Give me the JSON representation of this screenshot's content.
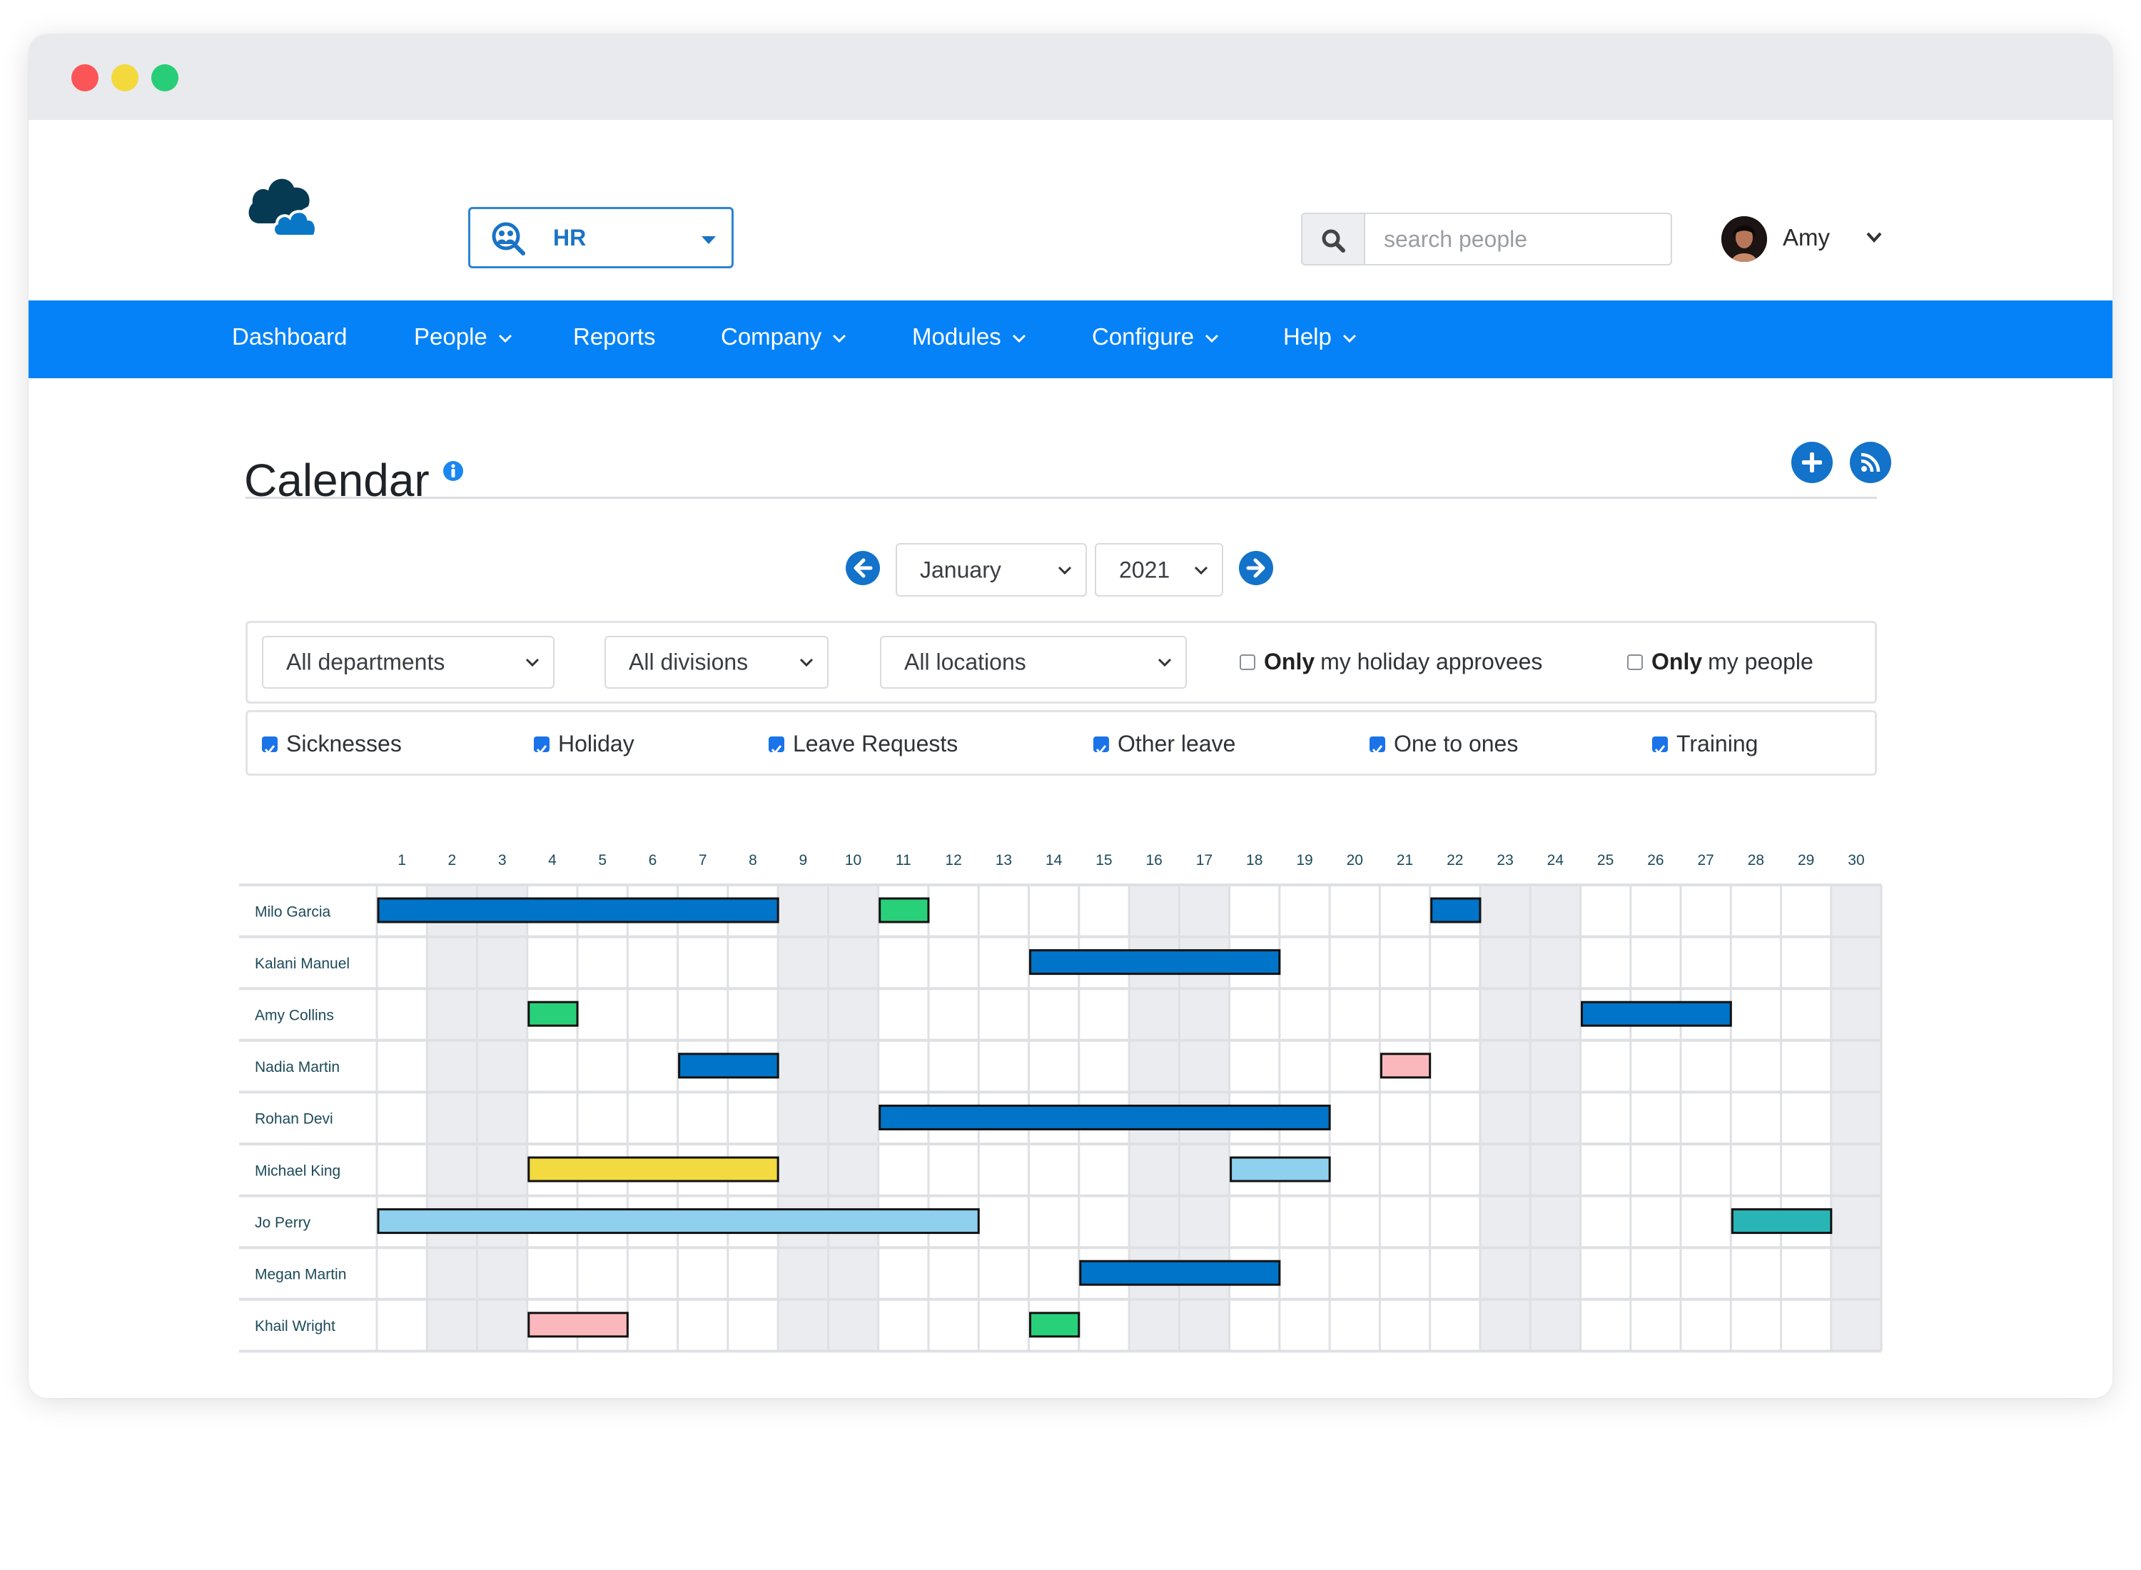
{
  "window": {
    "traffic_lights": [
      "close",
      "minimize",
      "maximize"
    ]
  },
  "header": {
    "module_select": {
      "value": "HR",
      "icon": "people-search-icon"
    },
    "search": {
      "placeholder": "search people",
      "value": "",
      "icon": "search-icon"
    },
    "user": {
      "name": "Amy",
      "avatar": "user-avatar-photo"
    }
  },
  "nav": {
    "items": [
      {
        "label": "Dashboard",
        "dropdown": false
      },
      {
        "label": "People",
        "dropdown": true
      },
      {
        "label": "Reports",
        "dropdown": false
      },
      {
        "label": "Company",
        "dropdown": true
      },
      {
        "label": "Modules",
        "dropdown": true
      },
      {
        "label": "Configure",
        "dropdown": true
      },
      {
        "label": "Help",
        "dropdown": true
      }
    ]
  },
  "page": {
    "title": "Calendar",
    "title_icon": "info-icon",
    "actions": [
      {
        "name": "add-event-button",
        "icon": "plus-icon"
      },
      {
        "name": "rss-feed-button",
        "icon": "rss-icon"
      }
    ]
  },
  "period": {
    "prev_icon": "arrow-left-icon",
    "next_icon": "arrow-right-icon",
    "month": "January",
    "year": "2021"
  },
  "filters": {
    "department": "All departments",
    "division": "All divisions",
    "location": "All locations",
    "holiday_approvees": {
      "bold": "Only",
      "rest": "my holiday approvees",
      "checked": false
    },
    "my_people": {
      "bold": "Only",
      "rest": "my people",
      "checked": false
    }
  },
  "event_types": [
    {
      "label": "Sicknesses",
      "checked": true
    },
    {
      "label": "Holiday",
      "checked": true
    },
    {
      "label": "Leave Requests",
      "checked": true
    },
    {
      "label": "Other leave",
      "checked": true
    },
    {
      "label": "One to ones",
      "checked": true
    },
    {
      "label": "Training",
      "checked": true
    }
  ],
  "colors": {
    "nav": "#0582f7",
    "accent": "#1372c9",
    "weekend": "#ebecef",
    "holiday": "#0074c8",
    "sickness": "#fbb8bc",
    "one_to_one": "#29d07a",
    "training": "#f2da40",
    "other_leave": "#8ed0ee",
    "leave_request": "#29b5b6"
  },
  "calendar": {
    "days_in_month": 30,
    "weekend_days": [
      2,
      3,
      9,
      10,
      16,
      17,
      23,
      24,
      30
    ],
    "people": [
      {
        "name": "Milo Garcia",
        "events": [
          {
            "start": 1,
            "end": 8,
            "color": "holiday"
          },
          {
            "start": 11,
            "end": 11,
            "color": "one_to_one"
          },
          {
            "start": 22,
            "end": 22,
            "color": "holiday"
          }
        ]
      },
      {
        "name": "Kalani Manuel",
        "events": [
          {
            "start": 14,
            "end": 18,
            "color": "holiday"
          }
        ]
      },
      {
        "name": "Amy Collins",
        "events": [
          {
            "start": 4,
            "end": 4,
            "color": "one_to_one"
          },
          {
            "start": 25,
            "end": 27,
            "color": "holiday"
          }
        ]
      },
      {
        "name": "Nadia Martin",
        "events": [
          {
            "start": 7,
            "end": 8,
            "color": "holiday"
          },
          {
            "start": 21,
            "end": 21,
            "color": "sickness"
          }
        ]
      },
      {
        "name": "Rohan Devi",
        "events": [
          {
            "start": 11,
            "end": 19,
            "color": "holiday"
          }
        ]
      },
      {
        "name": "Michael King",
        "events": [
          {
            "start": 4,
            "end": 8,
            "color": "training"
          },
          {
            "start": 18,
            "end": 19,
            "color": "other_leave"
          }
        ]
      },
      {
        "name": "Jo Perry",
        "events": [
          {
            "start": 1,
            "end": 12,
            "color": "other_leave"
          },
          {
            "start": 28,
            "end": 29,
            "color": "leave_request"
          }
        ]
      },
      {
        "name": "Megan Martin",
        "events": [
          {
            "start": 15,
            "end": 18,
            "color": "holiday"
          }
        ]
      },
      {
        "name": "Khail Wright",
        "events": [
          {
            "start": 4,
            "end": 5,
            "color": "sickness"
          },
          {
            "start": 14,
            "end": 14,
            "color": "one_to_one"
          }
        ]
      }
    ]
  }
}
